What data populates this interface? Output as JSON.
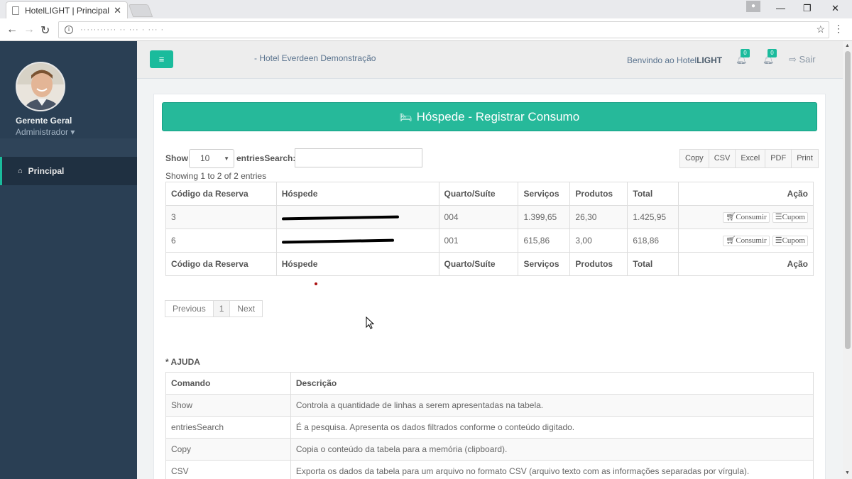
{
  "browser": {
    "tab_title": "HotelLIGHT | Principal",
    "tab_close": "✕",
    "url": "···········  ·· ··· ·  ··· ·"
  },
  "sidebar": {
    "user_name": "Gerente Geral",
    "user_role": "Administrador",
    "items": [
      {
        "label": "Principal",
        "icon": "home-icon"
      }
    ]
  },
  "topnav": {
    "menu_icon": "≡",
    "hotel_name": "- Hotel Everdeen Demonstração",
    "welcome_prefix": "Benvindo ao Hotel",
    "welcome_brand": "LIGHT",
    "notifications": [
      {
        "count": "0",
        "icon": "bell-icon"
      },
      {
        "count": "0",
        "icon": "bell-icon"
      }
    ],
    "logout_label": "Sair"
  },
  "panel": {
    "title": "Hóspede - Registrar Consumo",
    "show_label": "Show",
    "show_value": "10",
    "entries_search_label": "entriesSearch:",
    "search_value": "",
    "export_buttons": [
      "Copy",
      "CSV",
      "Excel",
      "PDF",
      "Print"
    ],
    "info": "Showing 1 to 2 of 2 entries",
    "columns": [
      "Código da Reserva",
      "Hóspede",
      "Quarto/Suíte",
      "Serviços",
      "Produtos",
      "Total",
      "Ação"
    ],
    "rows": [
      {
        "reserva": "3",
        "hospede": "",
        "quarto": "004",
        "servicos": "1.399,65",
        "produtos": "26,30",
        "total": "1.425,95"
      },
      {
        "reserva": "6",
        "hospede": "",
        "quarto": "001",
        "servicos": "615,86",
        "produtos": "3,00",
        "total": "618,86"
      }
    ],
    "action_consumir": "Consumir",
    "action_cupom": "Cupom",
    "pagination": {
      "previous": "Previous",
      "current": "1",
      "next": "Next"
    }
  },
  "help": {
    "title": "* AJUDA",
    "columns": [
      "Comando",
      "Descrição"
    ],
    "rows": [
      {
        "comando": "Show",
        "descricao": "Controla a quantidade de linhas a serem apresentadas na tabela."
      },
      {
        "comando": "entriesSearch",
        "descricao": "É a pesquisa. Apresenta os dados filtrados conforme o conteúdo digitado."
      },
      {
        "comando": "Copy",
        "descricao": "Copia o conteúdo da tabela para a memória (clipboard)."
      },
      {
        "comando": "CSV",
        "descricao": "Exporta os dados da tabela para um arquivo no formato CSV (arquivo texto com as informações separadas por vírgula)."
      }
    ]
  },
  "colors": {
    "accent": "#1abb9c",
    "sidebar": "#2a3f54",
    "header_green": "#26b99a"
  }
}
